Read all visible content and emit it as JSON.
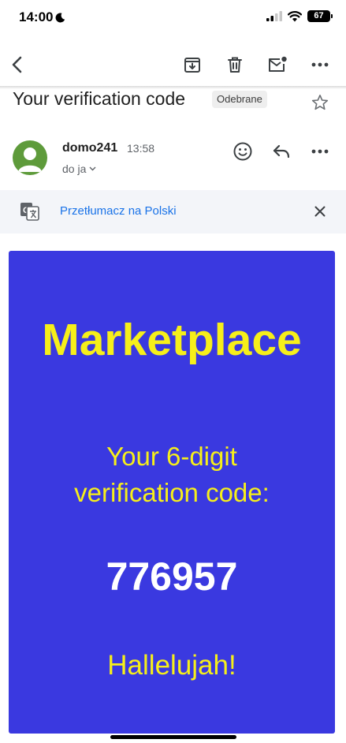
{
  "status": {
    "time": "14:00",
    "battery": "67"
  },
  "toolbar": {
    "back_icon": "back-arrow-icon",
    "archive_icon": "archive-icon",
    "delete_icon": "trash-icon",
    "unread_icon": "mark-unread-icon",
    "more_icon": "more-horizontal-icon"
  },
  "email": {
    "subject": "Your verification code",
    "label": "Odebrane",
    "sender": {
      "name": "domo241",
      "time": "13:58",
      "recipient": "do ja"
    }
  },
  "translate": {
    "text": "Przetłumacz na Polski"
  },
  "body": {
    "brand": "Marketplace",
    "code_label_line1": "Your 6-digit",
    "code_label_line2": "verification code:",
    "code": "776957",
    "closing": "Hallelujah!",
    "bg_color": "#3a39e0",
    "accent_color": "#f6ef1a"
  }
}
